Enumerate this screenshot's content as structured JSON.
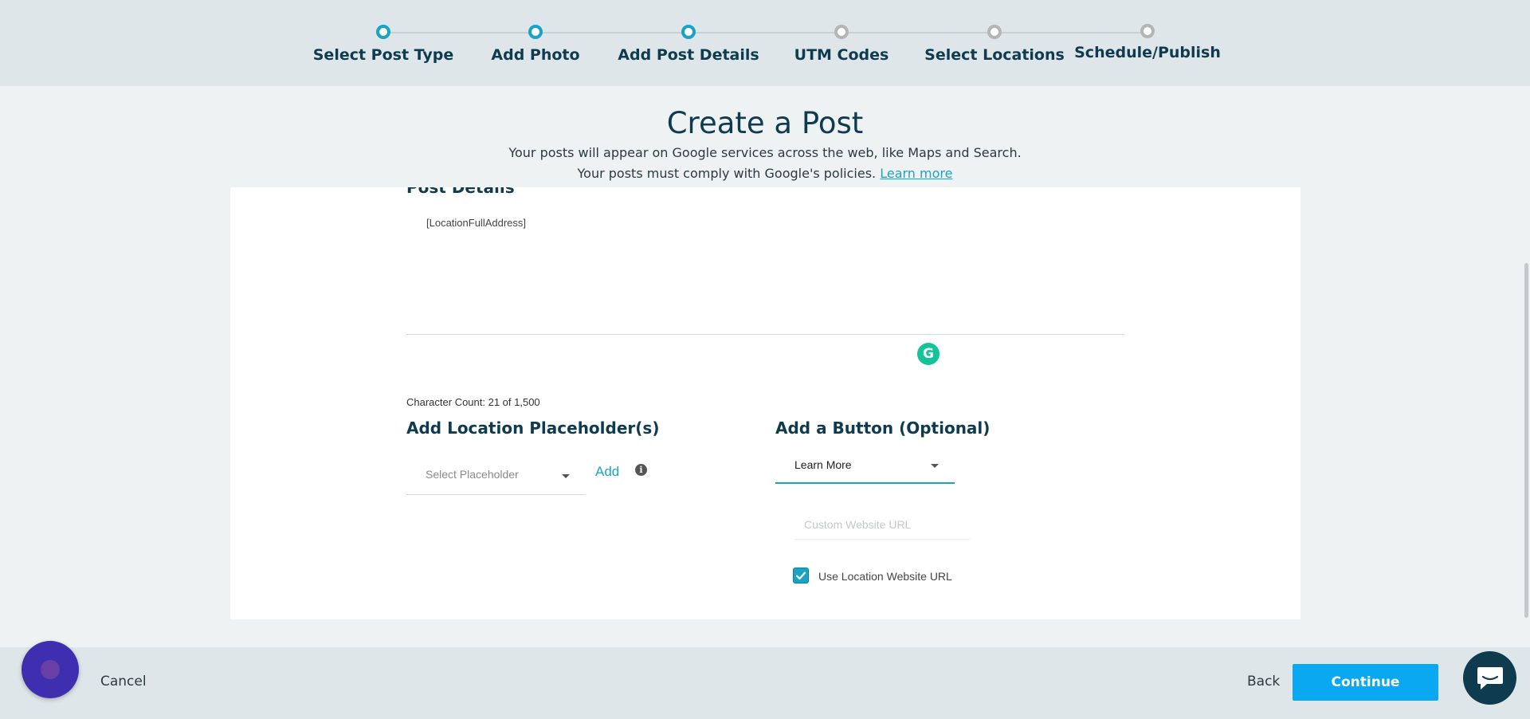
{
  "stepper": {
    "steps": [
      {
        "label": "Select Post Type",
        "state": "complete"
      },
      {
        "label": "Add Photo",
        "state": "complete"
      },
      {
        "label": "Add Post Details",
        "state": "current"
      },
      {
        "label": "UTM Codes",
        "state": "pending"
      },
      {
        "label": "Select Locations",
        "state": "pending"
      },
      {
        "label": "Schedule/Publish",
        "state": "pending"
      }
    ]
  },
  "header": {
    "title": "Create a Post",
    "subtitle_line1": "Your posts will appear on Google services across the web, like Maps and Search.",
    "subtitle_line2": "Your posts must comply with Google's policies.",
    "learn_more": "Learn more"
  },
  "post_details": {
    "section_title": "Post Details",
    "editor_text": "[LocationFullAddress]",
    "grammarly_glyph": "G",
    "character_count": "Character Count: 21 of 1,500"
  },
  "placeholders": {
    "heading": "Add Location Placeholder(s)",
    "select_placeholder": "Select Placeholder",
    "add_label": "Add",
    "info_glyph": "i"
  },
  "button_section": {
    "heading": "Add a Button (Optional)",
    "selected_button": "Learn More",
    "url_placeholder": "Custom Website URL",
    "checkbox_label": "Use Location Website URL",
    "checkbox_checked": true
  },
  "footer": {
    "cancel": "Cancel",
    "back": "Back",
    "continue": "Continue"
  },
  "colors": {
    "accent": "#1aa3c3",
    "primary_button": "#0aa8f0",
    "heading_text": "#0f3b4f"
  }
}
